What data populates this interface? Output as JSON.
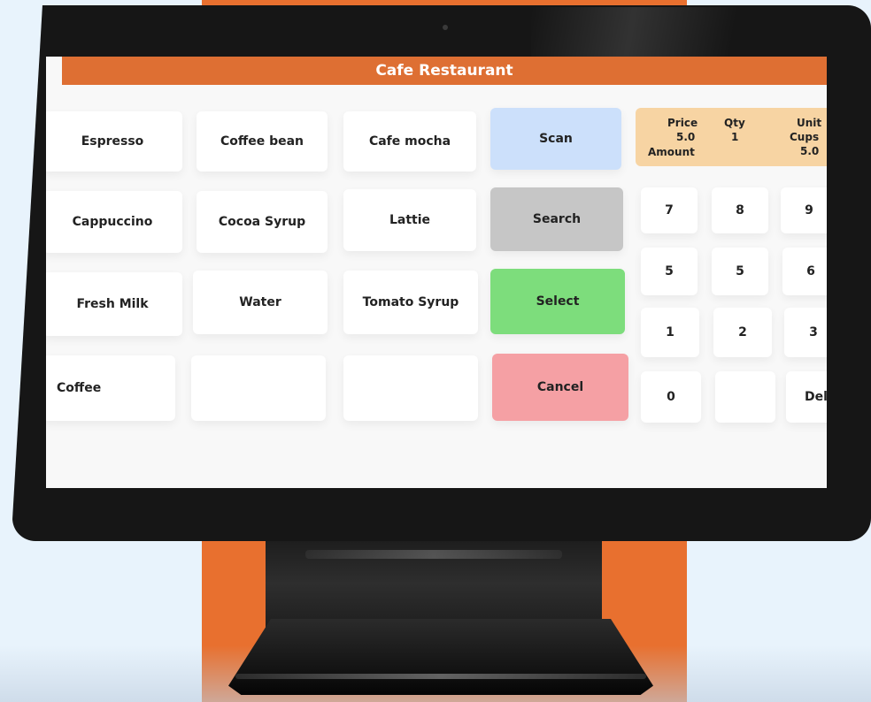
{
  "window": {
    "title": "Cafe Restaurant"
  },
  "colors": {
    "title_bar": "#de6f33",
    "scan": "#cce0fb",
    "search": "#c6c6c6",
    "select": "#7ddd7c",
    "cancel": "#f5a0a4",
    "summary": "#f7d4a3",
    "backdrop_accent": "#e8702f"
  },
  "products": [
    {
      "label": "Espresso"
    },
    {
      "label": "Coffee bean"
    },
    {
      "label": "Cafe mocha"
    },
    {
      "label": "Cappuccino"
    },
    {
      "label": "Cocoa Syrup"
    },
    {
      "label": "Lattie"
    },
    {
      "label": "Fresh Milk"
    },
    {
      "label": "Water"
    },
    {
      "label": "Tomato Syrup"
    },
    {
      "label": "Coffee"
    },
    {
      "label": ""
    },
    {
      "label": ""
    }
  ],
  "actions": {
    "scan": "Scan",
    "search": "Search",
    "select": "Select",
    "cancel": "Cancel"
  },
  "summary": {
    "price_label": "Price",
    "price_value": "5.0",
    "amount_label": "Amount",
    "qty_label": "Qty",
    "qty_value": "1",
    "unit_label": "Unit",
    "unit_type": "Cups",
    "unit_value": "5.0"
  },
  "keypad": [
    "7",
    "8",
    "9",
    "5",
    "5",
    "6",
    "1",
    "2",
    "3",
    "0",
    "",
    "Del"
  ]
}
